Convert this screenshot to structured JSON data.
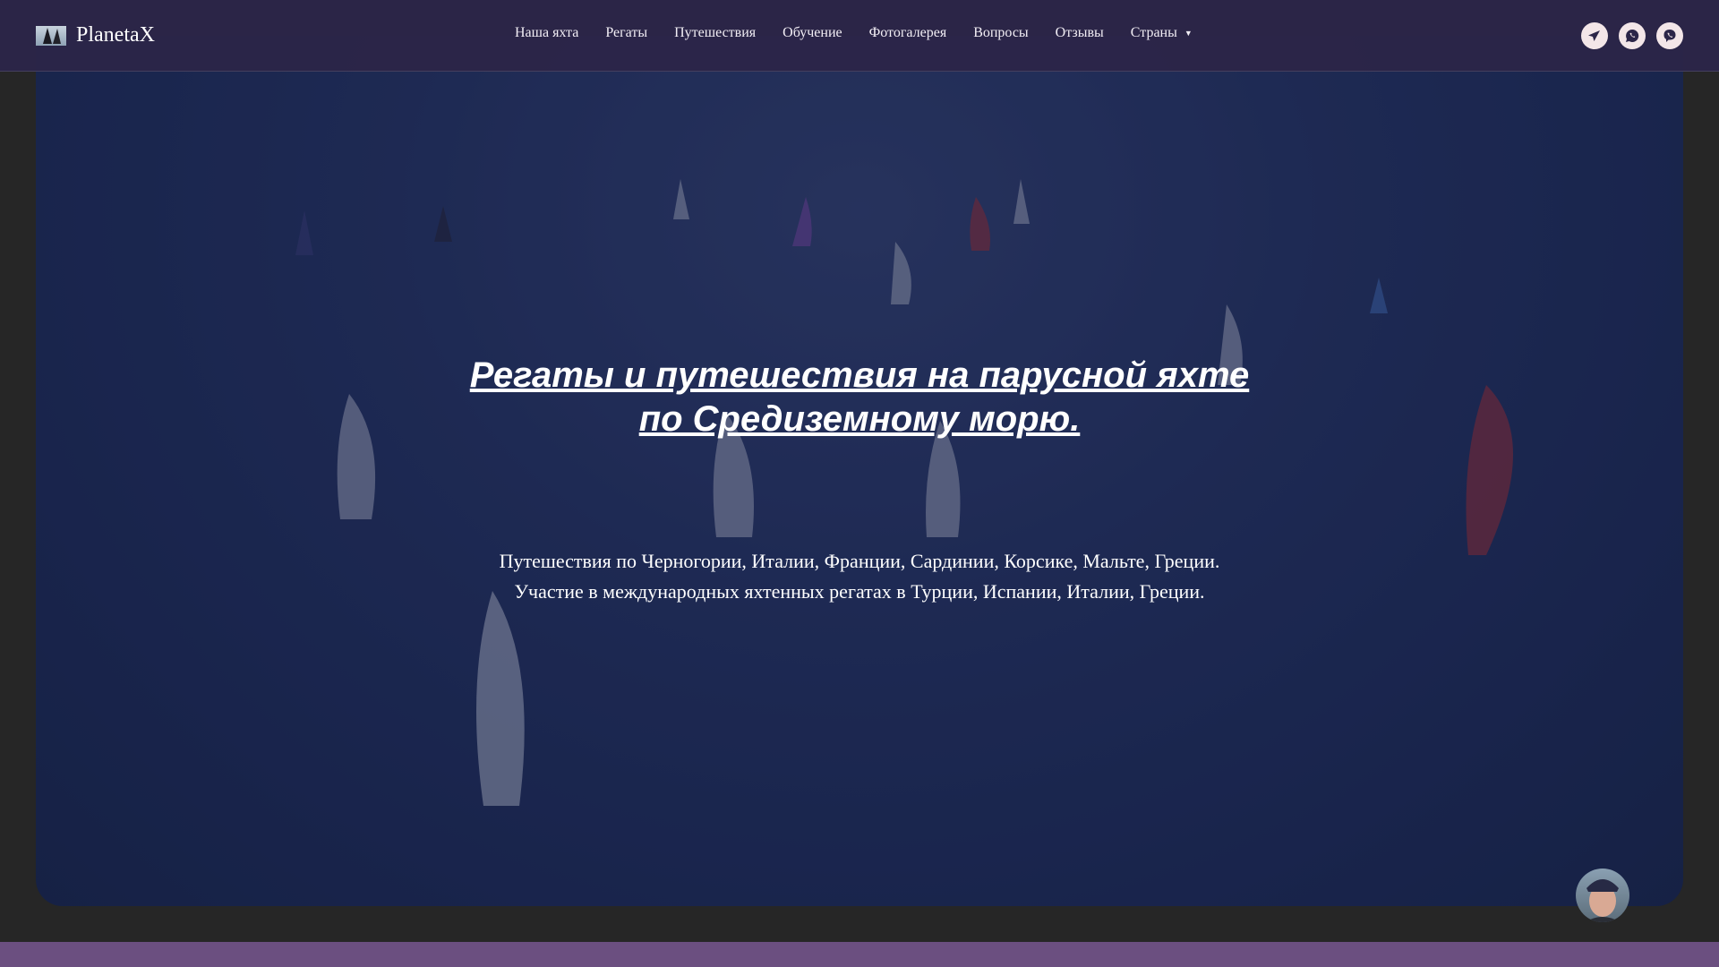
{
  "header": {
    "logo_text": "PlanetaX",
    "nav": [
      "Наша яхта",
      "Регаты",
      "Путешествия",
      "Обучение",
      "Фотогалерея",
      "Вопросы",
      "Отзывы",
      "Страны"
    ],
    "socials": [
      "telegram-icon",
      "whatsapp-icon",
      "viber-icon"
    ]
  },
  "hero": {
    "title_line1": "Регаты и путешествия на парусной яхте",
    "title_line2": "по Средиземному морю.",
    "sub_line1": "Путешествия по Черногории, Италии, Франции, Сардинии, Корсике, Мальте, Греции.",
    "sub_line2": "Участие в международных яхтенных регатах в Турции, Испании, Италии, Греции."
  },
  "colors": {
    "header": "#2b2548",
    "band": "#6b4f80",
    "body": "#262626"
  }
}
